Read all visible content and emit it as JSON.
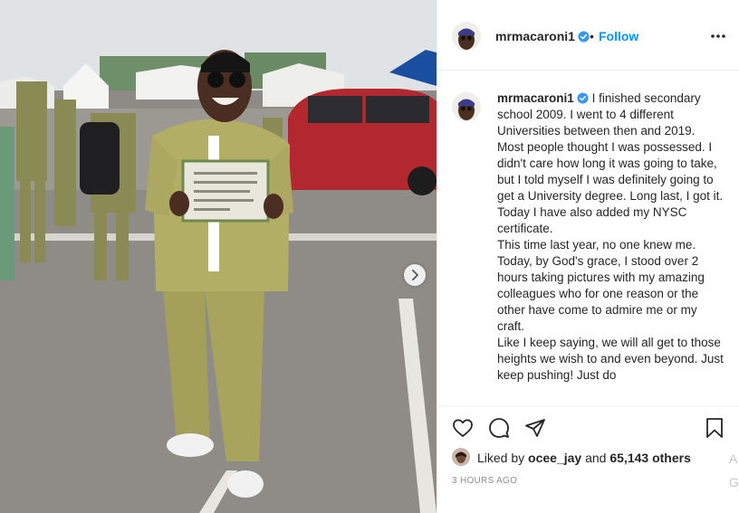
{
  "post": {
    "username": "mrmacaroni1",
    "follow_label": "Follow",
    "separator": "•",
    "more_icon": "more-options-icon",
    "verified_icon": "verified-badge-icon",
    "caption_lines": [
      "I finished secondary school 2009. I went to 4 different Universities between then and 2019. Most people thought I was possessed. I didn't care how long it was going to take, but I told myself I was definitely going to get a University degree. Long last, I got it.",
      "Today I have also added my NYSC certificate.",
      "This time last year, no one knew me. Today, by God's grace, I stood over 2 hours taking pictures with my amazing colleagues who for one reason or the other have come to admire me or my craft.",
      "Like I keep saying, we will all get to those heights we wish to and even beyond. Just keep pushing! Just do"
    ],
    "likes": {
      "prefix": "Liked by",
      "user": "ocee_jay",
      "conjunction": "and",
      "count": "65,143 others"
    },
    "time_ago": "3 HOURS AGO",
    "cutoff_chars": [
      "A",
      "G"
    ]
  },
  "actions": {
    "like_icon": "heart-icon",
    "comment_icon": "comment-icon",
    "share_icon": "share-icon",
    "save_icon": "bookmark-icon"
  },
  "photo": {
    "description_icon": "post-photo",
    "next_icon": "chevron-right-icon",
    "brand_color_accent": "#0095f6"
  }
}
